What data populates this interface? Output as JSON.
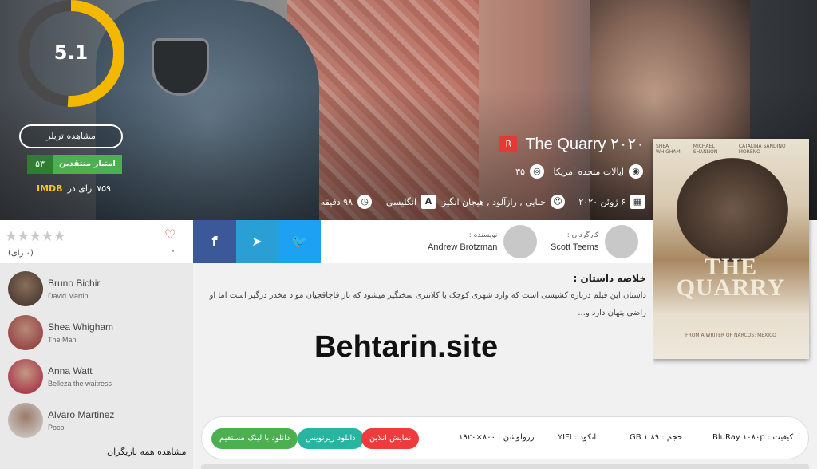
{
  "hero": {
    "score": "5.1",
    "score_fraction": 0.51,
    "trailer_label": "مشاهده تریلر",
    "critic_label": "امتیاز منتقدین",
    "critic_value": "۵۳",
    "imdb_votes": "۷۵۹",
    "imdb_text": "رای در",
    "imdb_tag": "IMDB",
    "rating_badge": "R",
    "title": "The Quarry ۲۰۲۰",
    "country": "ایالات متحده آمریکا",
    "views": "۳۵",
    "release_date": "۶ ژوئن ۲۰۲۰",
    "genres": "جنایی , رازآلود , هیجان انگیز",
    "language": "انگلیسی",
    "duration": "۹۸ دقیقه",
    "colors": {
      "score_ring": "#f5b800",
      "score_track": "#4a4a4a"
    }
  },
  "poster": {
    "names": [
      "SHEA WHIGHAM",
      "MICHAEL SHANNON",
      "CATALINA SANDINO MORENO"
    ],
    "title": "THE QUARRY",
    "tagline": "FROM A WRITER OF NARCOS: MEXICO"
  },
  "rating": {
    "stars": "★★★★★",
    "votes": "(۰ رای)",
    "likes": "۰"
  },
  "cast": [
    {
      "name": "Bruno Bichir",
      "role": "David Martin"
    },
    {
      "name": "Shea Whigham",
      "role": "The Man"
    },
    {
      "name": "Anna Watt",
      "role": "Belleza the waitress"
    },
    {
      "name": "Alvaro Martinez",
      "role": "Poco"
    }
  ],
  "all_cast_label": "مشاهده همه بازیگران",
  "social": {
    "facebook": "f",
    "telegram": "➤",
    "twitter": "🐦"
  },
  "crew": {
    "writer_role": "نویسنده :",
    "writer_name": "Andrew Brotzman",
    "director_role": "کارگردان :",
    "director_name": "Scott Teems"
  },
  "synopsis": {
    "title": "خلاصه داستان :",
    "text": "داستان این فیلم درباره کشیشی است که وارد شهری کوچک با کلانتری سختگیر میشود که باز قاچاقچیان مواد مخدر درگیر است اما او راضی پنهان دارد و..."
  },
  "watermark": "Behtarin.site",
  "download": {
    "quality": "کیفیت :",
    "quality_value": "BluRay ۱۰۸۰p",
    "size_label": "حجم :",
    "size_value": "GB ۱.۸۹",
    "encode_label": "انکود :",
    "encode_value": "YIFI",
    "resolution_label": "رزولوشن :",
    "resolution_value": "۸۰۰×۱۹۲۰",
    "online_label": "نمایش انلاین",
    "subtitle_label": "دانلود زیرنویس",
    "direct_label": "دانلود با لینک مستقیم"
  }
}
